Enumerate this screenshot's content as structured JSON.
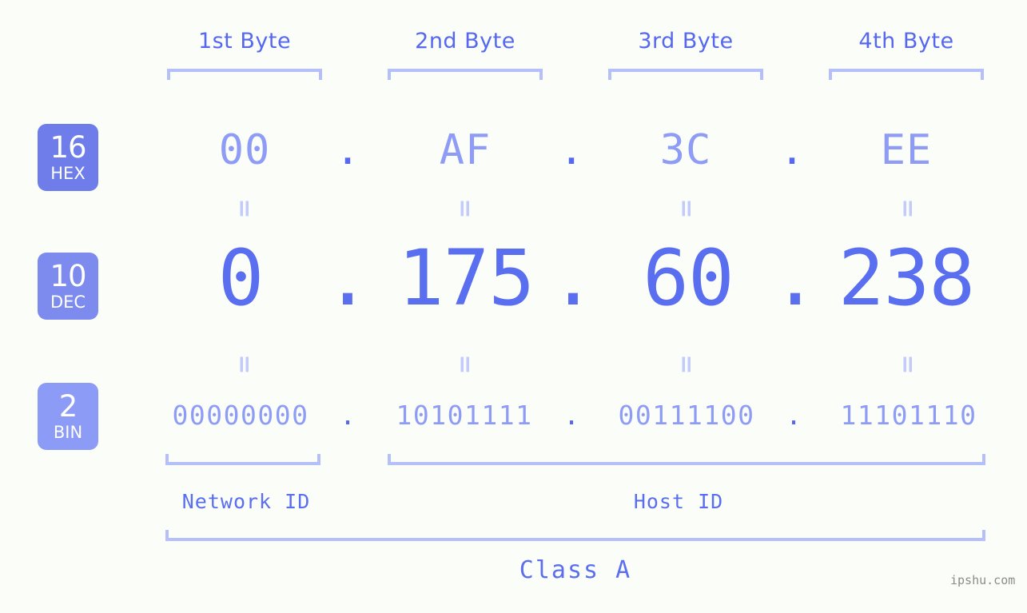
{
  "background_color": "#fbfdf8",
  "colors": {
    "accent_strong": "#5a6ef0",
    "accent_light": "#8e9cf6",
    "bracket": "#b5bffa",
    "equals": "#c3cbfb",
    "badge_hex": "#6e7dea",
    "badge_dec": "#7d8bef",
    "badge_bin": "#8c9bf5"
  },
  "byte_headers": [
    {
      "label": "1st Byte"
    },
    {
      "label": "2nd Byte"
    },
    {
      "label": "3rd Byte"
    },
    {
      "label": "4th Byte"
    }
  ],
  "radix_badges": [
    {
      "number": "16",
      "word": "HEX",
      "color": "#6e7dea"
    },
    {
      "number": "10",
      "word": "DEC",
      "color": "#7d8bef"
    },
    {
      "number": "2",
      "word": "BIN",
      "color": "#8c9bf5"
    }
  ],
  "rows": {
    "hex": {
      "radix": "16",
      "name": "HEX",
      "octets": [
        "00",
        "AF",
        "3C",
        "EE"
      ],
      "separator": "."
    },
    "dec": {
      "radix": "10",
      "name": "DEC",
      "octets": [
        "0",
        "175",
        "60",
        "238"
      ],
      "separator": "."
    },
    "bin": {
      "radix": "2",
      "name": "BIN",
      "octets": [
        "00000000",
        "10101111",
        "00111100",
        "11101110"
      ],
      "separator": "."
    }
  },
  "equals_glyph": "=",
  "segments": {
    "network_id": "Network ID",
    "host_id": "Host ID",
    "class": "Class A"
  },
  "watermark": "ipshu.com"
}
